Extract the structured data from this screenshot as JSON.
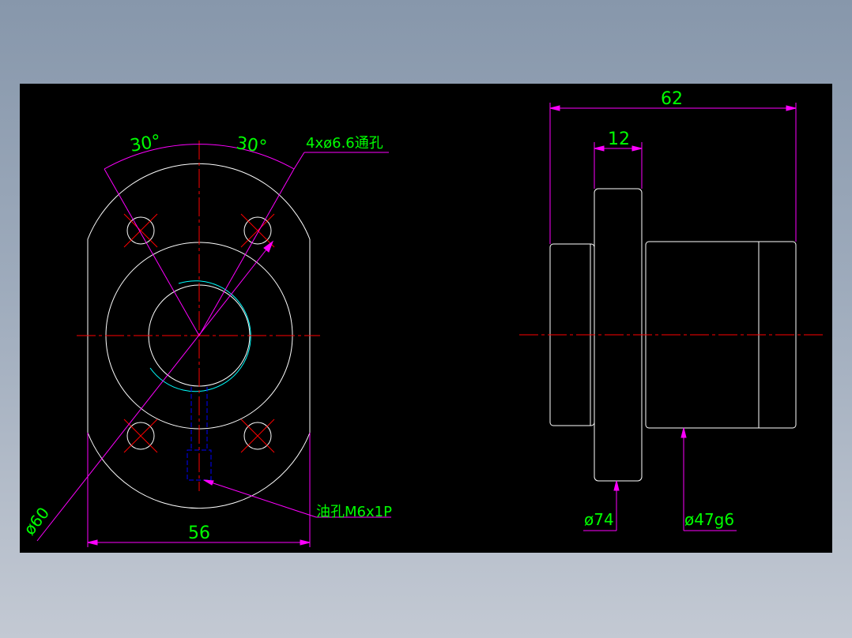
{
  "colors": {
    "background": "#000000",
    "outline": "#ffffff",
    "centerline": "#ff0000",
    "dimension_line": "#ff00ff",
    "dimension_text": "#00ff00",
    "hidden_line": "#0000ff",
    "thread_arc": "#00ffff"
  },
  "front_view": {
    "angle_left": "30°",
    "angle_right": "30°",
    "hole_note": "4xø6.6通孔",
    "pitch_circle_dia": "ø60",
    "flange_width": "56",
    "oil_hole_note": "油孔M6x1P"
  },
  "side_view": {
    "overall_length": "62",
    "flange_thickness": "12",
    "flange_dia": "ø74",
    "body_dia": "ø47g6"
  }
}
